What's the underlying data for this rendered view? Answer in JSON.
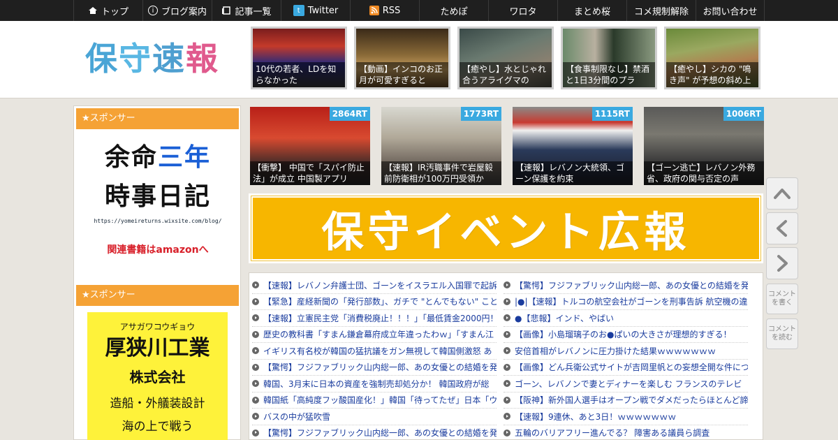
{
  "nav": {
    "items": [
      {
        "label": "トップ",
        "icon": "home-icon"
      },
      {
        "label": "ブログ案内",
        "icon": "info-icon"
      },
      {
        "label": "記事一覧",
        "icon": "list-icon"
      },
      {
        "label": "Twitter",
        "icon": "twitter-icon"
      },
      {
        "label": "RSS",
        "icon": "rss-icon"
      },
      {
        "label": "ためぽ"
      },
      {
        "label": "ワロタ"
      },
      {
        "label": "まとめ桜"
      },
      {
        "label": "コメ規制解除"
      },
      {
        "label": "お問い合わせ"
      }
    ]
  },
  "header": {
    "logo": [
      "保",
      "守",
      "速",
      "報"
    ],
    "thumbs": [
      {
        "caption": "10代の若者、LDを知らなかった"
      },
      {
        "caption": "【動画】インコのお正月が可愛すぎると"
      },
      {
        "caption": "【癒やし】水とじゃれ合うアライグマの"
      },
      {
        "caption": "【食事制限なし】禁酒と1日3分間のプラ"
      },
      {
        "caption": "【癒やし】シカの \"鳴き声\" が予想の斜め上"
      }
    ]
  },
  "sidebar": {
    "sponsor_label_1": "★スポンサー",
    "sponsor_label_2": "★スポンサー",
    "ad1": {
      "line1_a": "余命",
      "line1_b": "三年",
      "line2": "時事日記",
      "url": "https://yomeireturns.wixsite.com/blog/",
      "link": "関連書籍はamazonへ"
    },
    "ad2": {
      "kana": "アサガワコウギョウ",
      "name": "厚狭川工業",
      "company": "株式会社",
      "desc": "造船・外艤装設計",
      "more": "海の上で戦う"
    }
  },
  "trending": [
    {
      "rt": "2864RT",
      "caption": "【衝撃】 中国で「スパイ防止法」が成立 中国製アプリ"
    },
    {
      "rt": "1773RT",
      "caption": "【速報】IR汚職事件で岩屋毅前防衛相が100万円受領か"
    },
    {
      "rt": "1115RT",
      "caption": "【速報】レバノン大統領、ゴーン保護を約束"
    },
    {
      "rt": "1006RT",
      "caption": "【ゴーン逃亡】レバノン外務省、政府の関与否定の声"
    }
  ],
  "event_banner": {
    "text": "保守イベント広報"
  },
  "news": {
    "left": [
      "【速報】レバノン弁護士団、ゴーンをイスラエル入国罪で起訴",
      "【緊急】産経新聞の「発行部数」、ガチで \"とんでもない\" ことになっ",
      "【速報】立憲民主党「消費税廃止！！！」「最低賃金2000円！",
      "歴史の教科書「すまん鎌倉幕府成立年違ったわｗ」「すまん江",
      "イギリス有名校が韓国の猛抗議をガン無視して韓国側激怒 あ",
      "【驚愕】フジファブリック山内総一郎、あの女優との結婚を発",
      "韓国、3月末に日本の資産を強制売却処分か！ 韓国政府が総",
      "韓国紙「高純度フッ酸国産化！」韓国「待ってたぜ」日本「ウ",
      "バスの中が猛吹雪",
      "【驚愕】フジファブリック山内総一郎、あの女優との結婚を発"
    ],
    "right": [
      "【驚愕】フジファブリック山内総一郎、あの女優との結婚を発",
      "|●|【速報】トルコの航空会社がゴーンを刑事告訴 航空機の違",
      "●【悲報】インド、やばい",
      "【画像】小島瑠璃子のお●ぱいの大きさが理想的すぎる！",
      "安倍首相がレバノンに圧力掛けた結果ｗｗｗｗｗｗｗ",
      "【画像】どん兵衛公式サイトが吉岡里帆との妄想全開な件につ",
      "ゴーン、レバノンで妻とディナーを楽しむ フランスのテレビ",
      "【阪神】新外国人選手はオープン戦でダメだったらほとんど諦",
      "【速報】9連休、あと3日！ｗｗｗｗｗｗｗ",
      "五輪のバリアフリー進んでる？ 障害ある議員ら調査"
    ]
  },
  "float_buttons": {
    "comment_write": "コメントを書く",
    "comment_read": "コメントを読む"
  },
  "colors": {
    "nav_bg": "#1f1f1f",
    "sponsor_orange": "#f5a235",
    "rt_blue": "#3aa9e0",
    "event_yellow": "#f7b600",
    "link_blue": "#1a3c9e"
  }
}
